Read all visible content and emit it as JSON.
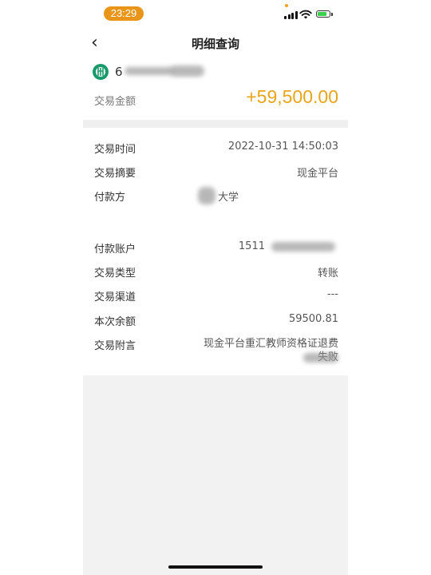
{
  "status_bar": {
    "time": "23:29"
  },
  "nav": {
    "back_glyph": "‹",
    "title": "明细查询"
  },
  "account": {
    "number_visible": "6"
  },
  "amount": {
    "label": "交易金额",
    "value": "+59,500.00"
  },
  "details": [
    {
      "label": "交易时间",
      "value": "2022-10-31 14:50:03"
    },
    {
      "label": "交易摘要",
      "value": "现金平台"
    },
    {
      "label": "付款方",
      "value": "大学"
    },
    {
      "label": "付款账户",
      "value": "1511"
    },
    {
      "label": "交易类型",
      "value": "转账"
    },
    {
      "label": "交易渠道",
      "value": "---"
    },
    {
      "label": "本次余额",
      "value": "59500.81"
    },
    {
      "label": "交易附言",
      "value": "现金平台重汇教师资格证退费失败"
    }
  ],
  "colors": {
    "amount": "#e8a51c",
    "bank_logo": "#1a9a6a",
    "time_pill": "#e8951a"
  },
  "icons": {
    "back": "chevron-left-icon",
    "bank": "abc-bank-logo-icon"
  }
}
